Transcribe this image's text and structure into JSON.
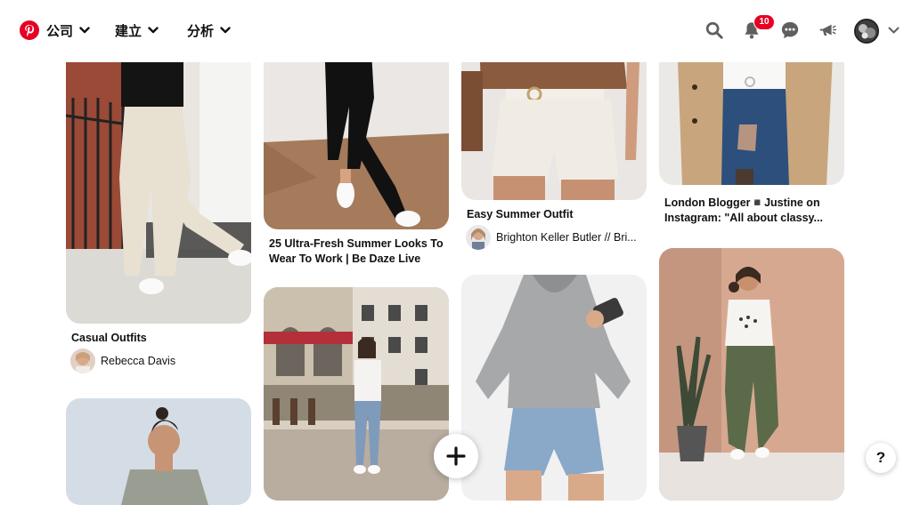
{
  "header": {
    "nav": [
      {
        "label": "公司"
      },
      {
        "label": "建立"
      },
      {
        "label": "分析"
      }
    ],
    "notification_count": "10",
    "brand_color": "#e60023"
  },
  "pins": [
    {
      "title": "Casual Outfits",
      "author": "Rebecca Davis"
    },
    {
      "title": "25 Ultra-Fresh Summer Looks To Wear To Work | Be Daze Live"
    },
    {
      "title": "Easy Summer Outfit",
      "author": "Brighton Keller Butler // Bri..."
    },
    {
      "title": "London Blogger◾️Justine on Instagram: \"All about classy..."
    }
  ],
  "fab": {
    "label": "+"
  },
  "help": {
    "label": "?"
  }
}
